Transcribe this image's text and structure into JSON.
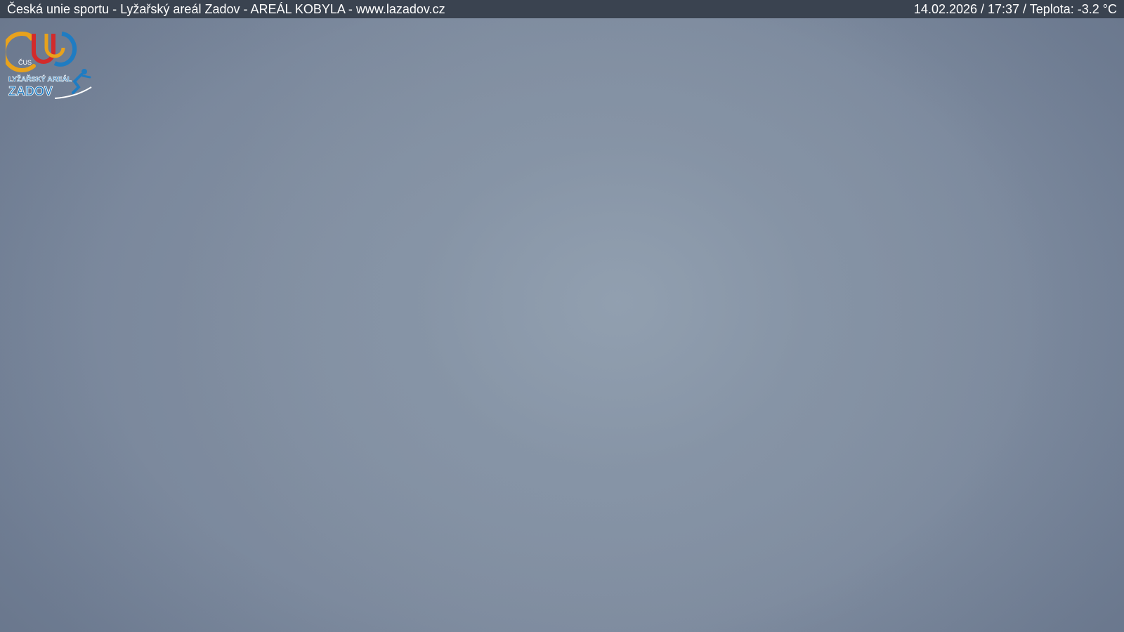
{
  "header": {
    "title": "Česká unie sportu - Lyžařský areál Zadov - AREÁL KOBYLA - www.lazadov.cz",
    "status": "14.02.2026 / 17:37 / Teplota: -3.2 °C"
  },
  "logo": {
    "top_text": "ČUS",
    "line1": "LYŽAŘSKÝ AREÁL",
    "line2": "ZADOV",
    "colors": {
      "gold": "#e8a21c",
      "blue": "#1f7cc2",
      "red": "#d22b2b",
      "white": "#ffffff"
    },
    "icon": "skier-icon"
  },
  "scene": {
    "colors": {
      "sky_center": "#92a0b0",
      "sky_edge": "#76849a",
      "bar": "#3a4350"
    }
  }
}
